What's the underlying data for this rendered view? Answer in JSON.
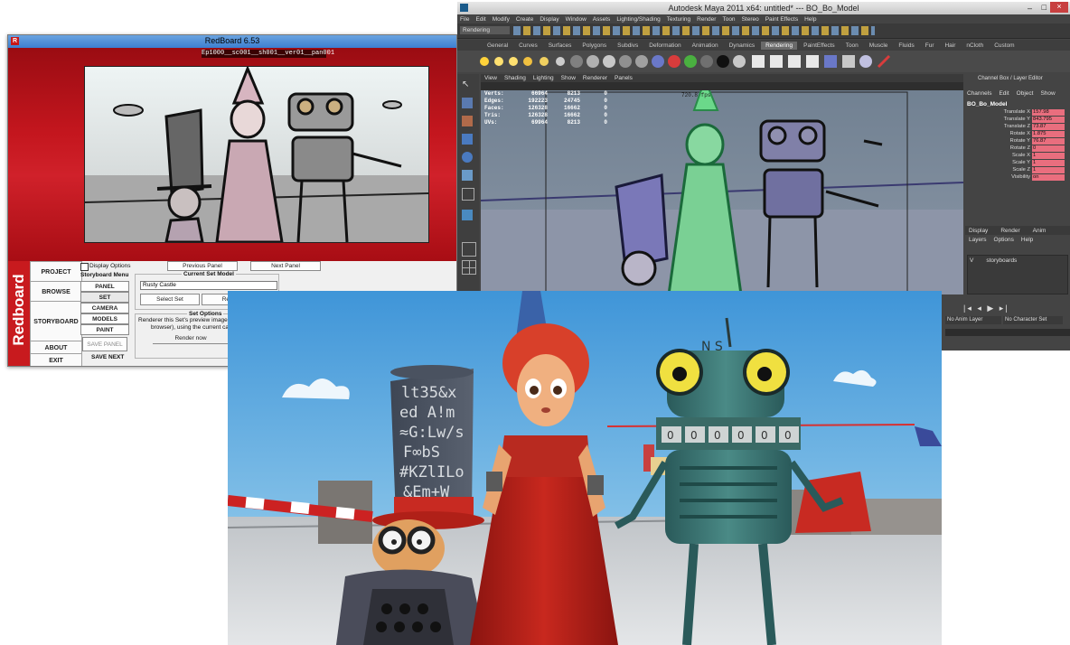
{
  "redboard": {
    "title": "RedBoard 6.53",
    "path": "Ep1000__sc001__sh001__ver01__pan001",
    "brand": "Redboard",
    "display_options": "Display Options",
    "previous_panel": "Previous Panel",
    "next_panel": "Next Panel",
    "nav": [
      "PROJECT",
      "BROWSE",
      "STORYBOARD",
      "ABOUT",
      "EXIT"
    ],
    "storyboard_menu": {
      "title": "Storyboard Menu",
      "items": [
        "PANEL",
        "SET",
        "CAMERA",
        "MODELS",
        "PAINT",
        "SAVE PANEL",
        "SAVE NEXT"
      ]
    },
    "current_set_model": {
      "title": "Current Set Model",
      "value": "Rusty Castle",
      "select_set": "Select Set",
      "re": "Re"
    },
    "set_options": {
      "title": "Set Options",
      "text_line1": "Renderer this Set's preview image",
      "text_line2": "browser), using the current cam",
      "render_now": "Render now"
    }
  },
  "maya": {
    "title": "Autodesk Maya 2011 x64: untitled*  ---  BO_Bo_Model",
    "menu": [
      "File",
      "Edit",
      "Modify",
      "Create",
      "Display",
      "Window",
      "Assets",
      "Lighting/Shading",
      "Texturing",
      "Render",
      "Toon",
      "Stereo",
      "Paint Effects",
      "Help"
    ],
    "mode": "Rendering",
    "shelf_tabs": [
      "General",
      "Curves",
      "Surfaces",
      "Polygons",
      "Subdivs",
      "Deformation",
      "Animation",
      "Dynamics",
      "Rendering",
      "PaintEffects",
      "Toon",
      "Muscle",
      "Fluids",
      "Fur",
      "Hair",
      "nCloth",
      "Custom"
    ],
    "active_shelf": "Rendering",
    "viewport_menu": [
      "View",
      "Shading",
      "Lighting",
      "Show",
      "Renderer",
      "Panels"
    ],
    "hud": [
      {
        "label": "Verts:",
        "a": "66964",
        "b": "8213",
        "c": "0"
      },
      {
        "label": "Edges:",
        "a": "192223",
        "b": "24745",
        "c": "0"
      },
      {
        "label": "Faces:",
        "a": "126328",
        "b": "16662",
        "c": "0"
      },
      {
        "label": "Tris:",
        "a": "126328",
        "b": "16662",
        "c": "0"
      },
      {
        "label": "UVs:",
        "a": "69964",
        "b": "8213",
        "c": "0"
      }
    ],
    "fps": "720.8 fps",
    "channel_box": {
      "title": "Channel Box / Layer Editor",
      "menu": [
        "Channels",
        "Edit",
        "Object",
        "Show"
      ],
      "object": "BO_Bo_Model",
      "attrs": [
        {
          "name": "Translate X",
          "value": "157.98"
        },
        {
          "name": "Translate Y",
          "value": "843.795"
        },
        {
          "name": "Translate Z",
          "value": "73.87"
        },
        {
          "name": "Rotate X",
          "value": "1.875"
        },
        {
          "name": "Rotate Y",
          "value": "76.87"
        },
        {
          "name": "Rotate Z",
          "value": "0"
        },
        {
          "name": "Scale X",
          "value": "1"
        },
        {
          "name": "Scale Y",
          "value": "1"
        },
        {
          "name": "Scale Z",
          "value": "1"
        },
        {
          "name": "Visibility",
          "value": "on"
        }
      ],
      "layer_tabs": [
        "Display",
        "Render",
        "Anim"
      ],
      "layer_menu": [
        "Layers",
        "Options",
        "Help"
      ],
      "layer_name": "storyboards",
      "layer_v": "V"
    },
    "no_anim_layer": "No Anim Layer",
    "no_character_set": "No Character Set"
  },
  "render": {
    "hat_text": [
      "lt35&x",
      "ed A!m",
      "≈G:Lw/s",
      "F∞bS",
      "#KZlILo",
      "&Em+W"
    ],
    "robot_letters": "N S",
    "counter": [
      "0",
      "0",
      "0",
      "0",
      "0",
      "0"
    ]
  },
  "colors": {
    "redboard_red": "#c81a1e",
    "maya_gray": "#444444",
    "channel_pink": "#e96e7e",
    "sky_blue": "#6fb8e8"
  }
}
